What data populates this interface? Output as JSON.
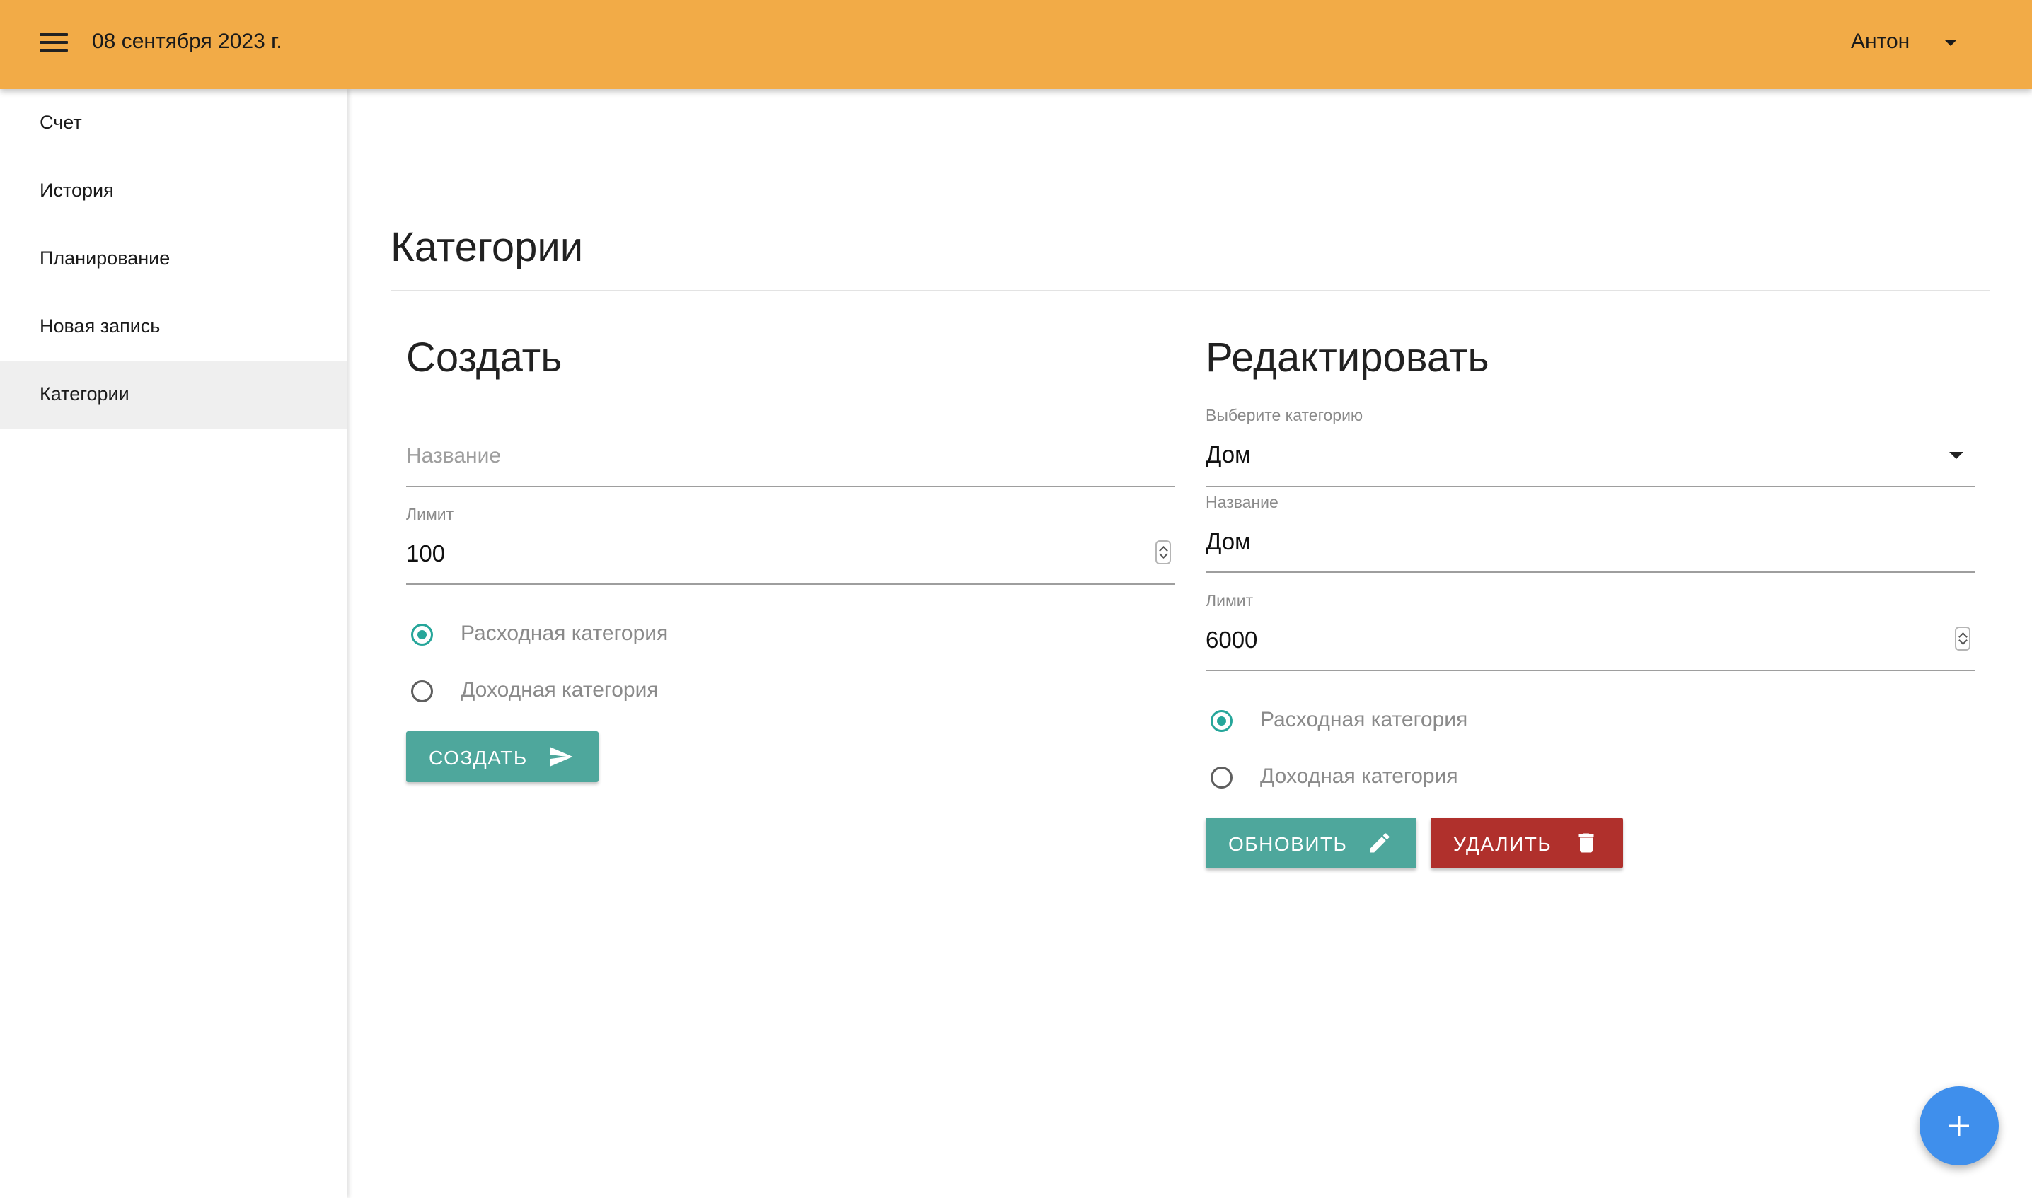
{
  "header": {
    "menu_icon": "menu-icon",
    "date": "08 сентября 2023 г.",
    "user_name": "Антон",
    "background_color": "#f2ab47"
  },
  "sidebar": {
    "items": [
      {
        "label": "Счет",
        "active": false
      },
      {
        "label": "История",
        "active": false
      },
      {
        "label": "Планирование",
        "active": false
      },
      {
        "label": "Новая запись",
        "active": false
      },
      {
        "label": "Категории",
        "active": true
      }
    ]
  },
  "page": {
    "title": "Категории"
  },
  "create": {
    "title": "Создать",
    "name_placeholder": "Название",
    "limit_label": "Лимит",
    "limit_value": "100",
    "radio_expense": "Расходная категория",
    "radio_income": "Доходная категория",
    "selected_type": "expense",
    "button_label": "СОЗДАТЬ",
    "button_icon": "send-icon"
  },
  "edit": {
    "title": "Редактировать",
    "select_label": "Выберите категорию",
    "select_value": "Дом",
    "name_label": "Название",
    "name_value": "Дом",
    "limit_label": "Лимит",
    "limit_value": "6000",
    "radio_expense": "Расходная категория",
    "radio_income": "Доходная категория",
    "selected_type": "expense",
    "update_label": "ОБНОВИТЬ",
    "update_icon": "pencil-icon",
    "delete_label": "УДАЛИТЬ",
    "delete_icon": "trash-icon"
  },
  "fab": {
    "icon": "plus-icon",
    "color": "#3f8fec"
  },
  "colors": {
    "accent_teal": "#4ea79c",
    "danger_red": "#b0302c"
  }
}
